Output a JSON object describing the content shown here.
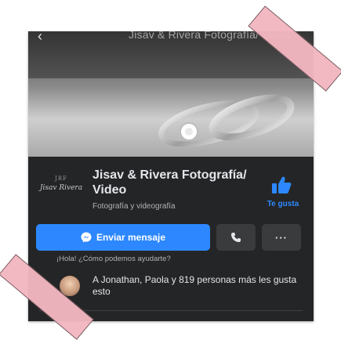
{
  "cover": {
    "title": "Jisav & Rivera Fotografía/ Video",
    "back": "‹"
  },
  "profile": {
    "name": "Jisav & Rivera Fotografía/ Video",
    "category": "Fotografía y videografía",
    "logo_text": "Jisav Rivera",
    "logo_mark": "JRF",
    "like_label": "Te gusta"
  },
  "actions": {
    "message_label": "Enviar mensaje",
    "call_icon": "phone-icon",
    "more_label": "···"
  },
  "greeting": "¡Hola! ¿Cómo podemos ayudarte?",
  "likes": {
    "text": "A Jonathan, Paola y 819 personas más les gusta esto"
  },
  "colors": {
    "background": "#242526",
    "accent": "#2d88ff",
    "tape": "#f3b7c1"
  }
}
